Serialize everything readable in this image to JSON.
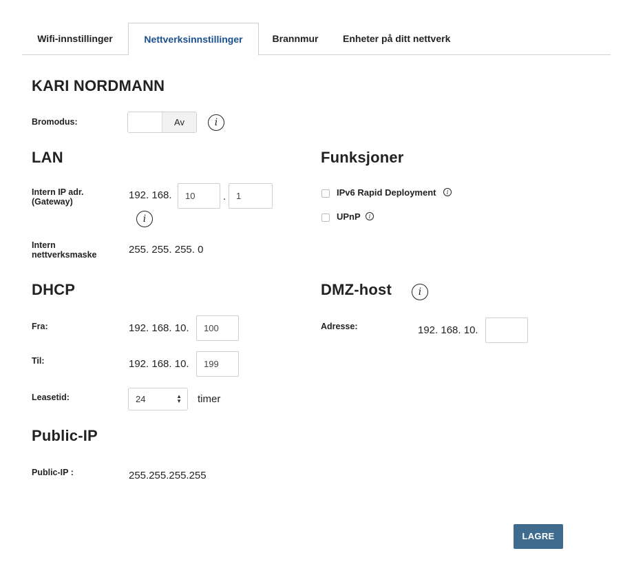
{
  "tabs": [
    {
      "label": "Wifi-innstillinger",
      "active": false
    },
    {
      "label": "Nettverksinnstillinger",
      "active": true
    },
    {
      "label": "Brannmur",
      "active": false
    },
    {
      "label": "Enheter på ditt nettverk",
      "active": false
    }
  ],
  "owner_name": "KARI NORDMANN",
  "bridge": {
    "label": "Bromodus:",
    "toggle_value": "Av"
  },
  "lan": {
    "heading": "LAN",
    "ip_label_line1": "Intern IP adr.",
    "ip_label_line2": "(Gateway)",
    "ip_prefix": "192. 168.",
    "ip_octet3": "10",
    "ip_separator": ".",
    "ip_octet4": "1",
    "mask_label_line1": "Intern",
    "mask_label_line2": "nettverksmaske",
    "mask_value": "255. 255. 255. 0"
  },
  "features": {
    "heading": "Funksjoner",
    "items": [
      {
        "label": "IPv6 Rapid Deployment",
        "checked": false
      },
      {
        "label": "UPnP",
        "checked": false
      }
    ]
  },
  "dhcp": {
    "heading": "DHCP",
    "from_label": "Fra:",
    "from_prefix": "192. 168. 10.",
    "from_value": "100",
    "to_label": "Til:",
    "to_prefix": "192. 168. 10.",
    "to_value": "199",
    "lease_label": "Leasetid:",
    "lease_value": "24",
    "lease_unit": "timer"
  },
  "dmz": {
    "heading": "DMZ-host",
    "address_label": "Adresse:",
    "address_prefix": "192. 168. 10.",
    "address_value": ""
  },
  "public_ip": {
    "heading": "Public-IP",
    "label": "Public-IP :",
    "value": "255.255.255.255"
  },
  "save_label": "LAGRE",
  "colors": {
    "accent": "#1a4f8f",
    "button": "#3f6c8e",
    "border": "#cfcfcf"
  }
}
